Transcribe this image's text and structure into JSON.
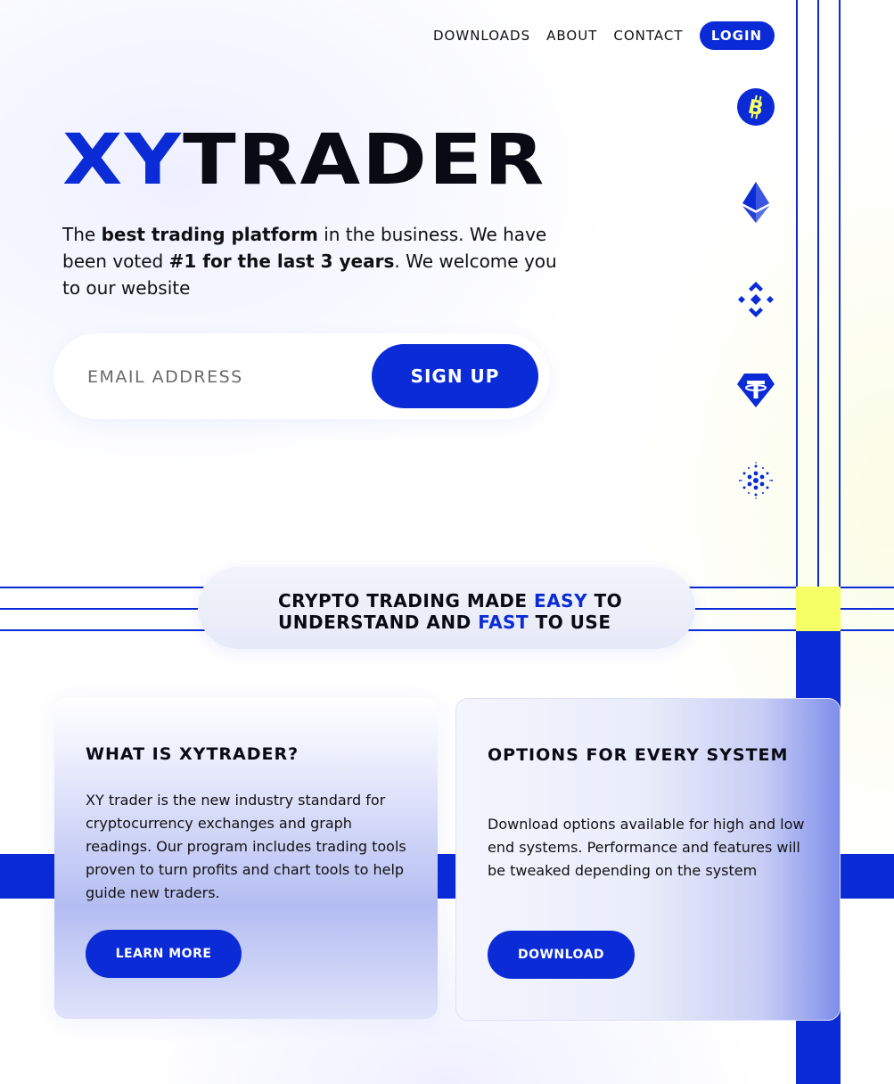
{
  "nav": {
    "links": [
      "DOWNLOADS",
      "ABOUT",
      "CONTACT"
    ],
    "login_label": "LOGIN"
  },
  "coins": [
    {
      "icon": "bitcoin-icon"
    },
    {
      "icon": "ethereum-icon"
    },
    {
      "icon": "binance-icon"
    },
    {
      "icon": "tether-icon"
    },
    {
      "icon": "cardano-icon"
    }
  ],
  "hero": {
    "logo_part1": "XY",
    "logo_part2": "TRADER",
    "text": {
      "p1": "The ",
      "b1": "best trading platform",
      "p2": " in the business. We have been voted ",
      "b2": "#1 for the last 3 years",
      "p3": ". We welcome you to our website"
    },
    "email_placeholder": "EMAIL ADDRESS",
    "signup_label": "SIGN UP"
  },
  "tagline": {
    "line1_a": "CRYPTO TRADING MADE ",
    "line1_hl": "EASY",
    "line1_b": " TO",
    "line2_a": "UNDERSTAND AND ",
    "line2_hl": "FAST",
    "line2_b": " TO USE"
  },
  "cards": [
    {
      "title": "WHAT IS XYTRADER?",
      "body": "XY trader is the new industry standard for cryptocurrency exchanges and graph readings. Our program includes trading tools proven to turn profits and chart tools to help guide new traders.",
      "button": "LEARN MORE"
    },
    {
      "title": "OPTIONS FOR EVERY SYSTEM",
      "body": "Download options available for high and low end systems.  Performance and features will be tweaked depending on the system",
      "button": "DOWNLOAD"
    }
  ],
  "colors": {
    "accent": "#0a2bd6",
    "highlight_yellow": "#f6ff66",
    "text": "#0a0a14"
  }
}
